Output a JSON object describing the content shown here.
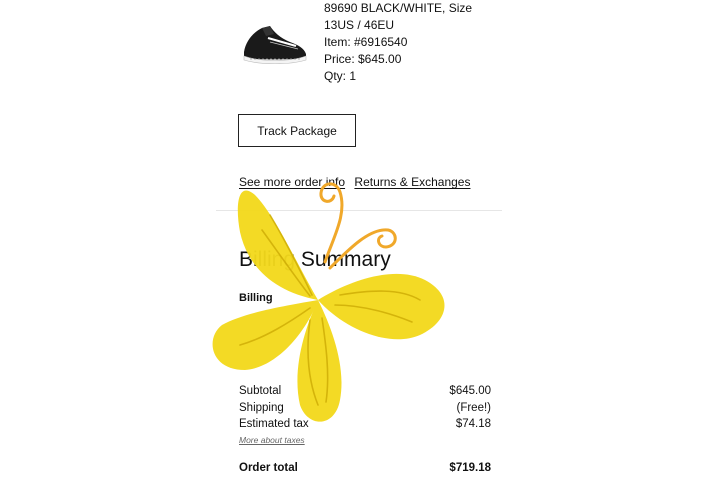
{
  "item": {
    "name": "89690 BLACK/WHITE, Size 13US / 46EU",
    "item_number": "Item: #6916540",
    "price": "Price: $645.00",
    "qty": "Qty: 1"
  },
  "actions": {
    "track_label": "Track Package",
    "more_info_label": "See more order info",
    "returns_label": "Returns & Exchanges"
  },
  "summary": {
    "title": "Billing Summary",
    "billing_label": "Billing"
  },
  "totals": {
    "subtotal_label": "Subtotal",
    "subtotal_value": "$645.00",
    "shipping_label": "Shipping",
    "shipping_value": "(Free!)",
    "tax_label": "Estimated tax",
    "tax_value": "$74.18",
    "taxes_link": "More about taxes",
    "order_total_label": "Order total",
    "order_total_value": "$719.18"
  },
  "colors": {
    "butterfly_fill": "#f2d81c",
    "butterfly_antenna": "#f0a82a"
  }
}
